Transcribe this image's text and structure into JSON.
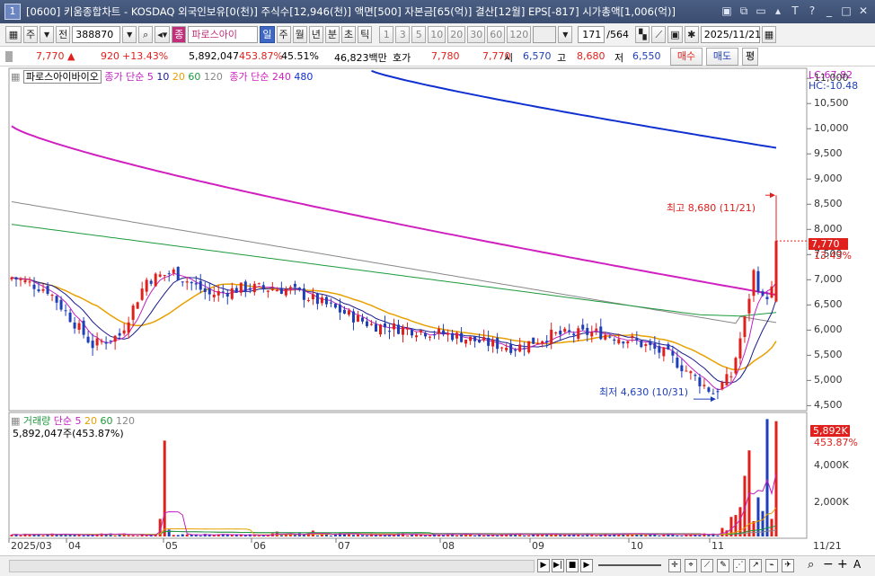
{
  "window": {
    "number": "1",
    "title": "[0600] 키움종합차트 - KOSDAQ 외국인보유[0(천)] 주식수[12,946(천)] 액면[500] 자본금[65(억)] 결산[12월] EPS[-817] 시가총액[1,006(억)]"
  },
  "toolbar": {
    "type_label": "주",
    "market_label": "전",
    "code": "388870",
    "name_badge": "종",
    "name": "파로스아이",
    "periods": [
      "일",
      "주",
      "월",
      "년",
      "분",
      "초",
      "틱"
    ],
    "intervals": [
      "1",
      "3",
      "5",
      "10",
      "20",
      "30",
      "60",
      "120"
    ],
    "count": "171",
    "total": "/564",
    "date": "2025/11/21"
  },
  "info": {
    "price": "7,770",
    "change": "920",
    "change_pct": "+13.43%",
    "volume": "5,892,047",
    "vol_ratio": "453.87%",
    "turnover": "45.51%",
    "amount": "46,823백만",
    "quote_label": "호가",
    "ask": "7,780",
    "bid": "7,770",
    "open_label": "시",
    "open": "6,570",
    "high_label": "고",
    "high": "8,680",
    "low_label": "저",
    "low": "6,550",
    "buy": "매수",
    "sell": "매도",
    "eval": "평"
  },
  "price_legend": {
    "name": "파로스아이바이오",
    "ma_label": "종가 단순",
    "ma_periods": [
      "5",
      "10",
      "20",
      "60",
      "120"
    ],
    "ma2_label": "종가 단순",
    "ma2_periods": [
      "240",
      "480"
    ]
  },
  "volume_legend": {
    "label": "거래량",
    "ma_label": "단순",
    "periods": [
      "5",
      "20",
      "60",
      "120"
    ],
    "value_text": "5,892,047주(453.87%)"
  },
  "right_axis": {
    "lc": "LC:67.82",
    "hc": "HC:-10.48",
    "ticks": [
      "11,000",
      "10,500",
      "10,000",
      "9,500",
      "9,000",
      "8,500",
      "8,000",
      "7,500",
      "7,000",
      "6,500",
      "6,000",
      "5,500",
      "5,000",
      "4,500"
    ],
    "price_tag": "7,770",
    "pct_tag": "13.43%",
    "vol_ticks": [
      "4,000K",
      "2,000K"
    ],
    "vol_tag": "5,892K",
    "vol_pct": "453.87%"
  },
  "annotations": {
    "high": "최고 8,680 (11/21)",
    "low": "최저 4,630 (10/31)"
  },
  "x_axis": [
    "2025/03",
    "04",
    "05",
    "06",
    "07",
    "08",
    "09",
    "10",
    "11",
    "11/21"
  ],
  "colors": {
    "up": "#e0201c",
    "down": "#1f3fb8",
    "ma5": "#c020c0",
    "ma10": "#1a1a8c",
    "ma20": "#e8a000",
    "ma60": "#1c9a3c",
    "ma120": "#888888",
    "ma240": "#d020c0",
    "ma480": "#1030d0"
  },
  "chart_data": {
    "type": "candlestick",
    "ylim": [
      4400,
      11200
    ],
    "high": 8680,
    "low": 4630,
    "last_close": 7770,
    "ma480_end": 9620,
    "ma240_end": 6700
  }
}
